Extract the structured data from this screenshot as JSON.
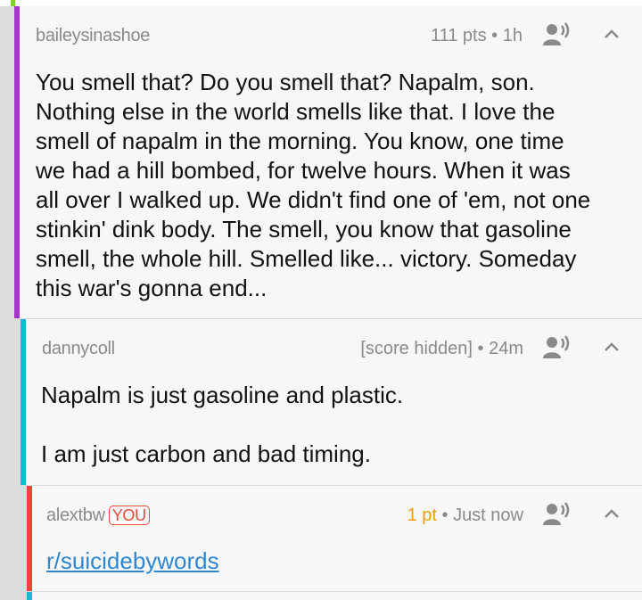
{
  "comments": [
    {
      "author": "baileysinashoe",
      "points": "111 pts",
      "separator": "•",
      "time": "1h",
      "bar_color": "#a335c9",
      "lines": [
        "You smell that? Do you smell that? Napalm, son.",
        "Nothing else in the world smells like that. I love the",
        "smell of napalm in the morning. You know, one time",
        "we had a hill bombed, for twelve hours. When it was",
        "all over I walked up. We didn't find one of 'em, not one",
        "stinkin' dink body. The smell, you know that gasoline",
        "smell, the whole hill. Smelled like... victory. Someday",
        "this war's gonna end..."
      ]
    },
    {
      "author": "dannycoll",
      "points": "[score hidden]",
      "separator": "•",
      "time": "24m",
      "bar_color": "#1eb6d6",
      "lines": [
        "Napalm is just gasoline and plastic.",
        "I am just carbon and bad timing."
      ]
    },
    {
      "author": "alextbw",
      "badge": "YOU",
      "points": "1 pt",
      "separator": "•",
      "time": "Just now",
      "bar_color": "#f0433a",
      "link": "r/suicidebywords"
    }
  ],
  "icons": {
    "speak": "text-to-speech-icon",
    "collapse": "chevron-up-icon"
  }
}
